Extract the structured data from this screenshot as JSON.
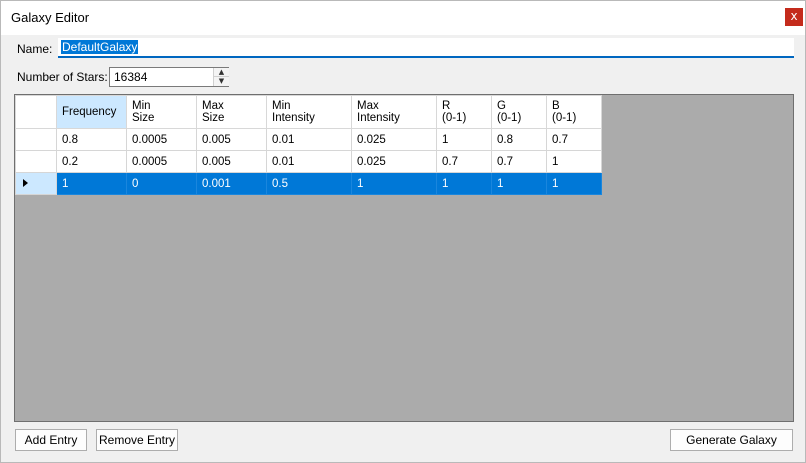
{
  "window": {
    "title": "Galaxy Editor",
    "close_glyph": "x"
  },
  "form": {
    "name_label": "Name:",
    "name_value": "DefaultGalaxy",
    "stars_label": "Number of Stars:",
    "stars_value": "16384"
  },
  "grid": {
    "columns": [
      {
        "line1": "Frequency",
        "line2": ""
      },
      {
        "line1": "Min",
        "line2": "Size"
      },
      {
        "line1": "Max",
        "line2": "Size"
      },
      {
        "line1": "Min",
        "line2": "Intensity"
      },
      {
        "line1": "Max",
        "line2": "Intensity"
      },
      {
        "line1": "R",
        "line2": "(0-1)"
      },
      {
        "line1": "G",
        "line2": "(0-1)"
      },
      {
        "line1": "B",
        "line2": "(0-1)"
      }
    ],
    "rows": [
      {
        "cells": [
          "0.8",
          "0.0005",
          "0.005",
          "0.01",
          "0.025",
          "1",
          "0.8",
          "0.7"
        ]
      },
      {
        "cells": [
          "0.2",
          "0.0005",
          "0.005",
          "0.01",
          "0.025",
          "0.7",
          "0.7",
          "1"
        ]
      },
      {
        "cells": [
          "1",
          "0",
          "0.001",
          "0.5",
          "1",
          "1",
          "1",
          "1"
        ]
      }
    ]
  },
  "buttons": {
    "add_entry": "Add Entry",
    "remove_entry": "Remove Entry",
    "generate_galaxy": "Generate Galaxy"
  },
  "colors": {
    "selection": "#0078d7",
    "header_selected": "#cce8ff",
    "grid_background": "#ababab",
    "close_button": "#c42b1c"
  }
}
